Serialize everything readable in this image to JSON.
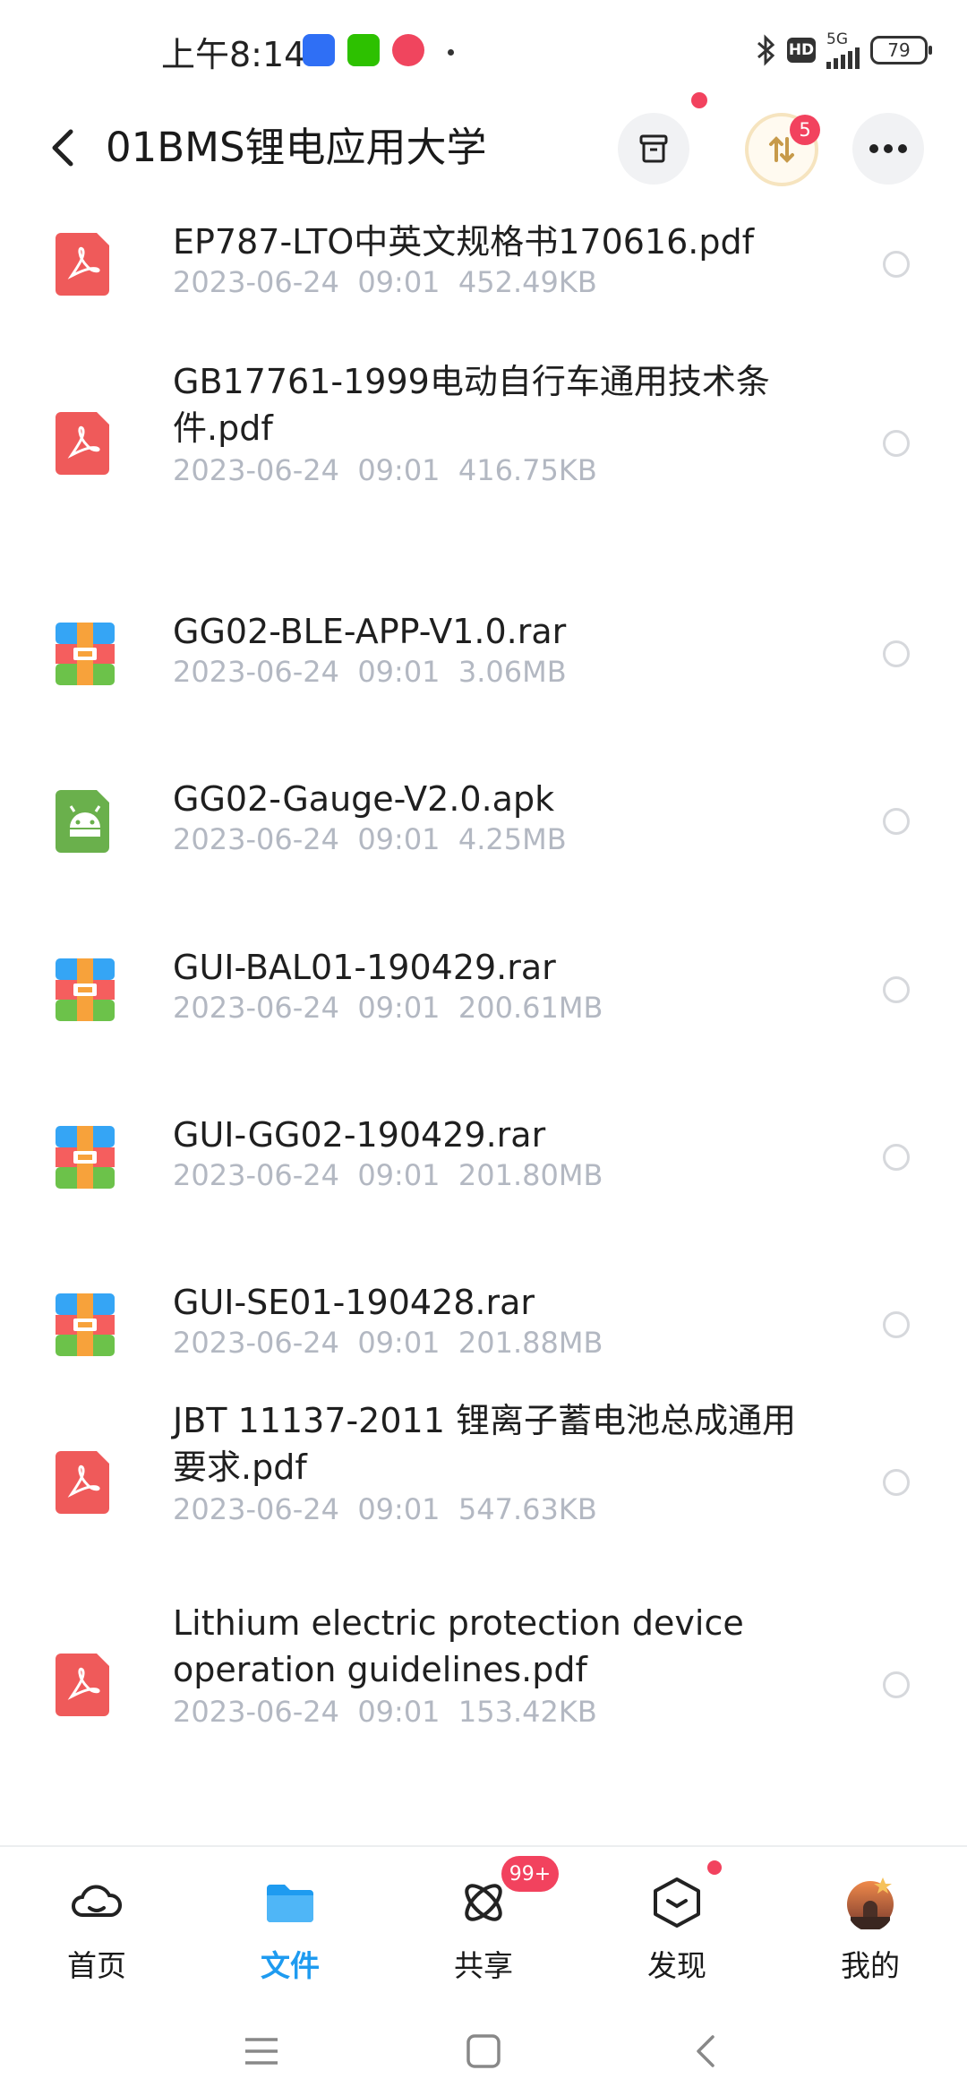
{
  "status_bar": {
    "time": "上午8:14",
    "hd_label": "HD",
    "network": "5G",
    "battery": "79"
  },
  "header": {
    "title": "01BMS锂电应用大学",
    "transfer_badge": "5"
  },
  "files": [
    {
      "name": "EP787-LTO中英文规格书170616.pdf",
      "meta": "2023-06-24  09:01  452.49KB",
      "type": "pdf-icon"
    },
    {
      "name": "GB17761-1999电动自行车通用技术条件.pdf",
      "meta": "2023-06-24  09:01  416.75KB",
      "type": "pdf-icon"
    },
    {
      "name": "GG02-BLE-APP-V1.0.rar",
      "meta": "2023-06-24  09:01  3.06MB",
      "type": "archive-icon"
    },
    {
      "name": "GG02-Gauge-V2.0.apk",
      "meta": "2023-06-24  09:01  4.25MB",
      "type": "android-apk-icon"
    },
    {
      "name": "GUI-BAL01-190429.rar",
      "meta": "2023-06-24  09:01  200.61MB",
      "type": "archive-icon"
    },
    {
      "name": "GUI-GG02-190429.rar",
      "meta": "2023-06-24  09:01  201.80MB",
      "type": "archive-icon"
    },
    {
      "name": "GUI-SE01-190428.rar",
      "meta": "2023-06-24  09:01  201.88MB",
      "type": "archive-icon"
    },
    {
      "name": "JBT 11137-2011 锂离子蓄电池总成通用要求.pdf",
      "meta": "2023-06-24  09:01  547.63KB",
      "type": "pdf-icon"
    },
    {
      "name": "Lithium electric protection device operation guidelines.pdf",
      "meta": "2023-06-24  09:01  153.42KB",
      "type": "pdf-icon"
    }
  ],
  "bottom_nav": [
    {
      "label": "首页",
      "icon": "cloud-home-icon"
    },
    {
      "label": "文件",
      "icon": "folder-icon"
    },
    {
      "label": "共享",
      "icon": "share-icon"
    },
    {
      "label": "发现",
      "icon": "discover-icon"
    },
    {
      "label": "我的",
      "icon": "avatar-icon"
    }
  ],
  "share_badge": "99+",
  "colors": {
    "accent": "#1e9bf0",
    "badge": "#f2425e",
    "meta_text": "#b3b8c2",
    "pdf": "#ef5a5a"
  }
}
